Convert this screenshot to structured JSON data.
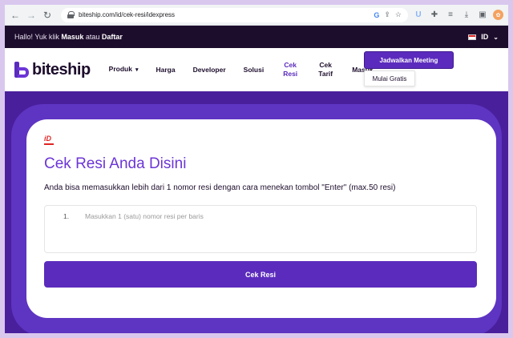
{
  "browser": {
    "url": "biteship.com/id/cek-resi/idexpress"
  },
  "topbar": {
    "greeting_prefix": "Hallo! Yuk klik ",
    "login": "Masuk",
    "or": " atau ",
    "register": "Daftar",
    "language": "ID"
  },
  "nav": {
    "logo": "biteship",
    "items": [
      {
        "label": "Produk"
      },
      {
        "label": "Harga"
      },
      {
        "label": "Developer"
      },
      {
        "label": "Solusi"
      },
      {
        "label": "Cek Resi"
      },
      {
        "label": "Cek Tarif"
      },
      {
        "label": "Masuk"
      }
    ],
    "cta_primary": "Jadwalkan Meeting",
    "cta_secondary": "Mulai Gratis"
  },
  "courier": {
    "logo_text": "iD"
  },
  "main": {
    "title": "Cek Resi Anda Disini",
    "description": "Anda bisa memasukkan lebih dari 1 nomor resi dengan cara menekan tombol \"Enter\" (max.50 resi)",
    "line_number": "1.",
    "placeholder": "Masukkan 1 (satu) nomor resi per baris",
    "submit_label": "Cek Resi"
  },
  "colors": {
    "brand": "#5b2bbd",
    "topbar_bg": "#1d0d2c",
    "title": "#6c35d6"
  }
}
